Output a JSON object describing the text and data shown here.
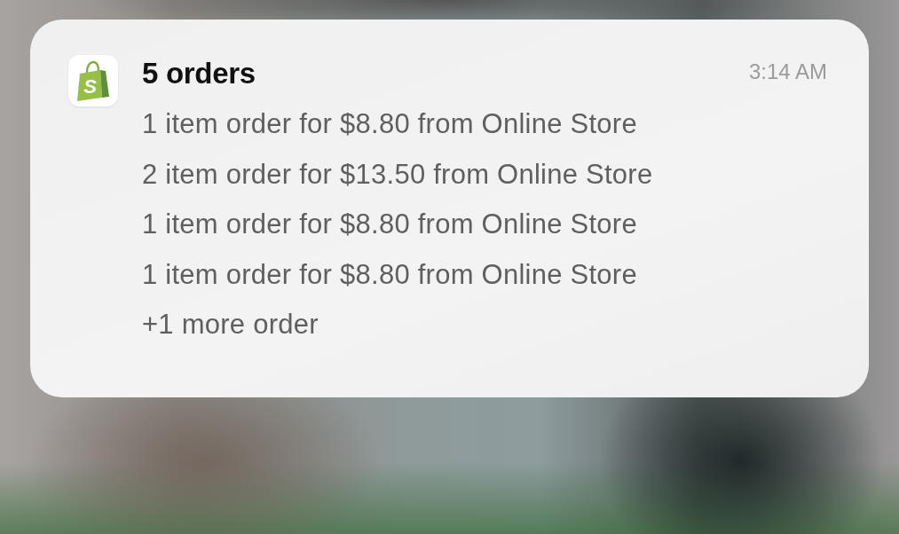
{
  "notification": {
    "app_icon": {
      "letter": "S"
    },
    "title": "5 orders",
    "time": "3:14 AM",
    "lines": [
      "1 item order for $8.80 from Online Store",
      "2 item order for $13.50 from Online Store",
      "1 item order for $8.80 from Online Store",
      "1 item order for $8.80 from Online Store",
      "+1 more order"
    ]
  }
}
